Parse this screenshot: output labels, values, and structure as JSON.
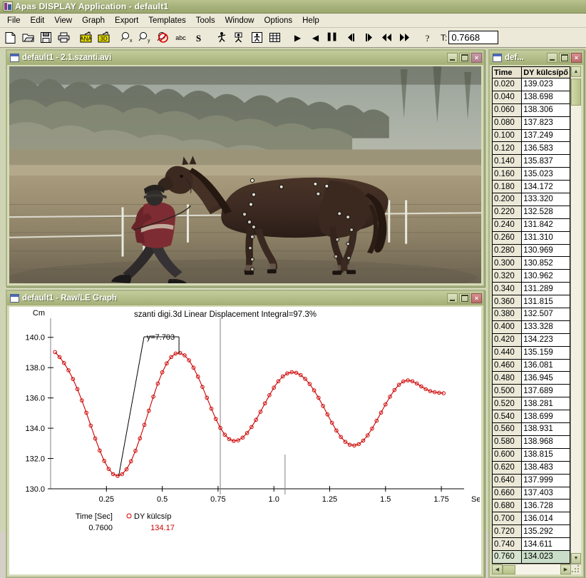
{
  "app": {
    "title": "Apas DISPLAY Application - default1",
    "icon": "app-icon"
  },
  "menu": [
    "File",
    "Edit",
    "View",
    "Graph",
    "Export",
    "Templates",
    "Tools",
    "Window",
    "Options",
    "Help"
  ],
  "toolbar": {
    "buttons": [
      {
        "name": "new-file-icon",
        "glyph": "□",
        "label": ""
      },
      {
        "name": "open-folder-icon",
        "glyph": "▱",
        "label": ""
      },
      {
        "name": "save-disk-icon",
        "glyph": "■",
        "label": ""
      },
      {
        "name": "print-icon",
        "glyph": "⎙",
        "label": ""
      },
      {
        "name": "analog-ana-icon",
        "glyph": "",
        "label": "ANA"
      },
      {
        "name": "three-d-icon",
        "glyph": "",
        "label": "3D"
      },
      {
        "name": "zoom-x-icon",
        "glyph": "⌕",
        "label": "x"
      },
      {
        "name": "zoom-y-icon",
        "glyph": "⌕",
        "label": "y"
      },
      {
        "name": "zoom-off-icon",
        "glyph": "⌕",
        "label": ""
      },
      {
        "name": "text-abc-icon",
        "glyph": "",
        "label": "abc"
      },
      {
        "name": "stick-s-icon",
        "glyph": "",
        "label": "S"
      },
      {
        "name": "stick-figure-icon",
        "glyph": "ƒ",
        "label": ""
      },
      {
        "name": "camera-icon",
        "glyph": "☉",
        "label": ""
      },
      {
        "name": "boxed-figure-icon",
        "glyph": "☷",
        "label": ""
      },
      {
        "name": "data-grid-icon",
        "glyph": "☷",
        "label": ""
      }
    ],
    "playback": [
      {
        "name": "play-button",
        "glyph": "▶"
      },
      {
        "name": "play-reverse-button",
        "glyph": "◀"
      },
      {
        "name": "pause-button",
        "glyph": "‖"
      },
      {
        "name": "step-back-button",
        "glyph": "◀|"
      },
      {
        "name": "step-forward-button",
        "glyph": "|▶"
      },
      {
        "name": "rewind-button",
        "glyph": "◀◀"
      },
      {
        "name": "fast-forward-button",
        "glyph": "▶▶"
      }
    ],
    "help_button": {
      "name": "help-icon",
      "glyph": "?"
    },
    "time_label": "T:",
    "time_value": "0.7668"
  },
  "video_window": {
    "title": "default1 - 2.1.szanti.avi",
    "min": "–",
    "max": "□",
    "close": "×"
  },
  "graph_window": {
    "title": "default1 - Raw/LE Graph",
    "min": "–",
    "max": "□",
    "close": "×"
  },
  "table_window": {
    "title": "def...",
    "min": "–",
    "max": "□",
    "close": "×",
    "columns": [
      "Time",
      "DY külcsípő"
    ],
    "rows": [
      [
        "0.020",
        "139.023"
      ],
      [
        "0.040",
        "138.698"
      ],
      [
        "0.060",
        "138.306"
      ],
      [
        "0.080",
        "137.823"
      ],
      [
        "0.100",
        "137.249"
      ],
      [
        "0.120",
        "136.583"
      ],
      [
        "0.140",
        "135.837"
      ],
      [
        "0.160",
        "135.023"
      ],
      [
        "0.180",
        "134.172"
      ],
      [
        "0.200",
        "133.320"
      ],
      [
        "0.220",
        "132.528"
      ],
      [
        "0.240",
        "131.842"
      ],
      [
        "0.260",
        "131.310"
      ],
      [
        "0.280",
        "130.969"
      ],
      [
        "0.300",
        "130.852"
      ],
      [
        "0.320",
        "130.962"
      ],
      [
        "0.340",
        "131.289"
      ],
      [
        "0.360",
        "131.815"
      ],
      [
        "0.380",
        "132.507"
      ],
      [
        "0.400",
        "133.328"
      ],
      [
        "0.420",
        "134.223"
      ],
      [
        "0.440",
        "135.159"
      ],
      [
        "0.460",
        "136.081"
      ],
      [
        "0.480",
        "136.945"
      ],
      [
        "0.500",
        "137.689"
      ],
      [
        "0.520",
        "138.281"
      ],
      [
        "0.540",
        "138.699"
      ],
      [
        "0.560",
        "138.931"
      ],
      [
        "0.580",
        "138.968"
      ],
      [
        "0.600",
        "138.815"
      ],
      [
        "0.620",
        "138.483"
      ],
      [
        "0.640",
        "137.999"
      ],
      [
        "0.660",
        "137.403"
      ],
      [
        "0.680",
        "136.728"
      ],
      [
        "0.700",
        "136.014"
      ],
      [
        "0.720",
        "135.292"
      ],
      [
        "0.740",
        "134.611"
      ],
      [
        "0.760",
        "134.023"
      ]
    ],
    "selected_row_index": 37
  },
  "chart_data": {
    "type": "line",
    "title": "szanti digi.3d Linear Displacement   Integral=97.3%",
    "xlabel": "Sec",
    "ylabel": "Cm",
    "xlim": [
      0.0,
      1.82
    ],
    "ylim": [
      130.0,
      140.6
    ],
    "xticks": [
      0.25,
      0.5,
      0.75,
      1.0,
      1.25,
      1.5,
      1.75
    ],
    "xtick_labels": [
      "0.25",
      "0.5",
      "0.75",
      "1.0",
      "1.25",
      "1.5",
      "1.75"
    ],
    "yticks": [
      130.0,
      132.0,
      134.0,
      136.0,
      138.0,
      140.0
    ],
    "ytick_labels": [
      "130.0",
      "132.0",
      "134.0",
      "136.0",
      "138.0",
      "140.0"
    ],
    "grid": false,
    "series": [
      {
        "name": "DY külcsíp",
        "color": "#cc0000",
        "marker": "circle",
        "x": [
          0.02,
          0.04,
          0.06,
          0.08,
          0.1,
          0.12,
          0.14,
          0.16,
          0.18,
          0.2,
          0.22,
          0.24,
          0.26,
          0.28,
          0.3,
          0.32,
          0.34,
          0.36,
          0.38,
          0.4,
          0.42,
          0.44,
          0.46,
          0.48,
          0.5,
          0.52,
          0.54,
          0.56,
          0.58,
          0.6,
          0.62,
          0.64,
          0.66,
          0.68,
          0.7,
          0.72,
          0.74,
          0.76,
          0.78,
          0.8,
          0.82,
          0.84,
          0.86,
          0.88,
          0.9,
          0.92,
          0.94,
          0.96,
          0.98,
          1.0,
          1.02,
          1.04,
          1.06,
          1.08,
          1.1,
          1.12,
          1.14,
          1.16,
          1.18,
          1.2,
          1.22,
          1.24,
          1.26,
          1.28,
          1.3,
          1.32,
          1.34,
          1.36,
          1.38,
          1.4,
          1.42,
          1.44,
          1.46,
          1.48,
          1.5,
          1.52,
          1.54,
          1.56,
          1.58,
          1.6,
          1.62,
          1.64,
          1.66,
          1.68,
          1.7,
          1.72,
          1.74,
          1.76
        ],
        "y": [
          139.023,
          138.698,
          138.306,
          137.823,
          137.249,
          136.583,
          135.837,
          135.023,
          134.172,
          133.32,
          132.528,
          131.842,
          131.31,
          130.969,
          130.852,
          130.962,
          131.289,
          131.815,
          132.507,
          133.328,
          134.223,
          135.159,
          136.081,
          136.945,
          137.689,
          138.281,
          138.699,
          138.931,
          138.968,
          138.815,
          138.483,
          137.999,
          137.403,
          136.728,
          136.014,
          135.292,
          134.611,
          134.023,
          133.57,
          133.28,
          133.16,
          133.2,
          133.38,
          133.68,
          134.08,
          134.56,
          135.09,
          135.64,
          136.18,
          136.68,
          137.1,
          137.42,
          137.62,
          137.7,
          137.66,
          137.51,
          137.26,
          136.92,
          136.5,
          136.01,
          135.47,
          134.91,
          134.36,
          133.85,
          133.42,
          133.1,
          132.91,
          132.86,
          132.95,
          133.18,
          133.53,
          133.98,
          134.49,
          135.03,
          135.57,
          136.08,
          136.52,
          136.87,
          137.09,
          137.16,
          137.1,
          136.95,
          136.76,
          136.58,
          136.45,
          136.38,
          136.34,
          136.31
        ]
      }
    ],
    "annotation": {
      "text": "y=7.703",
      "from_x": 0.305,
      "from_y": 130.852,
      "to_x": 0.575,
      "to_y": 138.92
    },
    "cursor_primary_x": 0.76,
    "cursor_secondary_x": 1.05,
    "legend": {
      "time_label": "Time [Sec]",
      "time_value": "0.7600",
      "series_label": "DY külcsíp",
      "series_value": "134.17"
    }
  }
}
